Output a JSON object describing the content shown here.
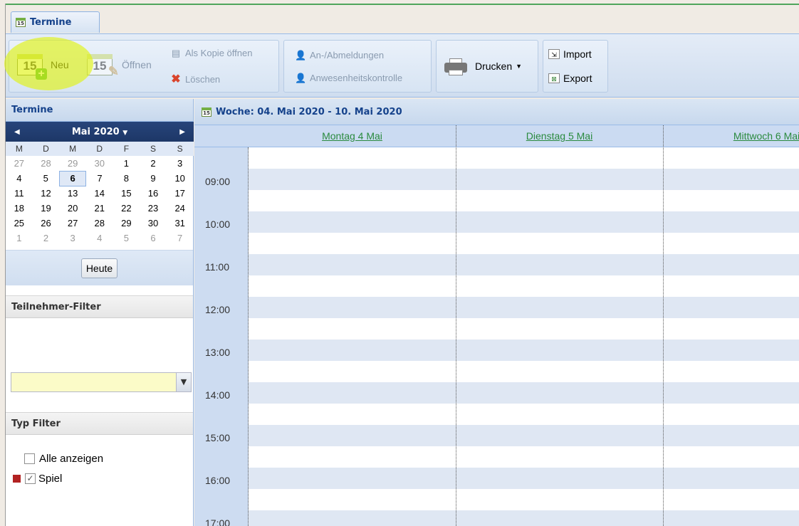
{
  "tab": {
    "label": "Termine",
    "icon": "calendar-icon"
  },
  "toolbar": {
    "new_label": "Neu",
    "open_label": "Öffnen",
    "copy_label": "Als Kopie öffnen",
    "delete_label": "Löschen",
    "registration_label": "An-/Abmeldungen",
    "attendance_label": "Anwesenheitskontrolle",
    "print_label": "Drucken",
    "import_label": "Import",
    "export_label": "Export",
    "calendar_icon_day": "15"
  },
  "sidebar": {
    "title": "Termine",
    "month_label": "Mai 2020",
    "weekdays": [
      "M",
      "D",
      "M",
      "D",
      "F",
      "S",
      "S"
    ],
    "weeks": [
      [
        {
          "d": "27",
          "g": true
        },
        {
          "d": "28",
          "g": true
        },
        {
          "d": "29",
          "g": true
        },
        {
          "d": "30",
          "g": true
        },
        {
          "d": "1"
        },
        {
          "d": "2"
        },
        {
          "d": "3"
        }
      ],
      [
        {
          "d": "4"
        },
        {
          "d": "5"
        },
        {
          "d": "6",
          "sel": true
        },
        {
          "d": "7"
        },
        {
          "d": "8"
        },
        {
          "d": "9"
        },
        {
          "d": "10"
        }
      ],
      [
        {
          "d": "11"
        },
        {
          "d": "12"
        },
        {
          "d": "13"
        },
        {
          "d": "14"
        },
        {
          "d": "15"
        },
        {
          "d": "16"
        },
        {
          "d": "17"
        }
      ],
      [
        {
          "d": "18"
        },
        {
          "d": "19"
        },
        {
          "d": "20"
        },
        {
          "d": "21"
        },
        {
          "d": "22"
        },
        {
          "d": "23"
        },
        {
          "d": "24"
        }
      ],
      [
        {
          "d": "25"
        },
        {
          "d": "26"
        },
        {
          "d": "27"
        },
        {
          "d": "28"
        },
        {
          "d": "29"
        },
        {
          "d": "30"
        },
        {
          "d": "31"
        }
      ],
      [
        {
          "d": "1",
          "g": true
        },
        {
          "d": "2",
          "g": true
        },
        {
          "d": "3",
          "g": true
        },
        {
          "d": "4",
          "g": true
        },
        {
          "d": "5",
          "g": true
        },
        {
          "d": "6",
          "g": true
        },
        {
          "d": "7",
          "g": true
        }
      ]
    ],
    "today_label": "Heute",
    "participant_filter_title": "Teilnehmer-Filter",
    "participant_filter_value": "",
    "type_filter_title": "Typ Filter",
    "show_all_label": "Alle anzeigen",
    "show_all_checked": false,
    "spiel_label": "Spiel",
    "spiel_checked": true,
    "spiel_color": "#b22222"
  },
  "main": {
    "week_title": "Woche: 04. Mai 2020 - 10. Mai 2020",
    "days": [
      "Montag  4 Mai",
      "Dienstag  5 Mai",
      "Mittwoch  6 Mai"
    ],
    "times": [
      "09:00",
      "10:00",
      "11:00",
      "12:00",
      "13:00",
      "14:00",
      "15:00",
      "16:00",
      "17:00"
    ]
  },
  "colors": {
    "accent": "#15428b",
    "highlight": "#e1f214",
    "day_link": "#2a8a3e"
  }
}
